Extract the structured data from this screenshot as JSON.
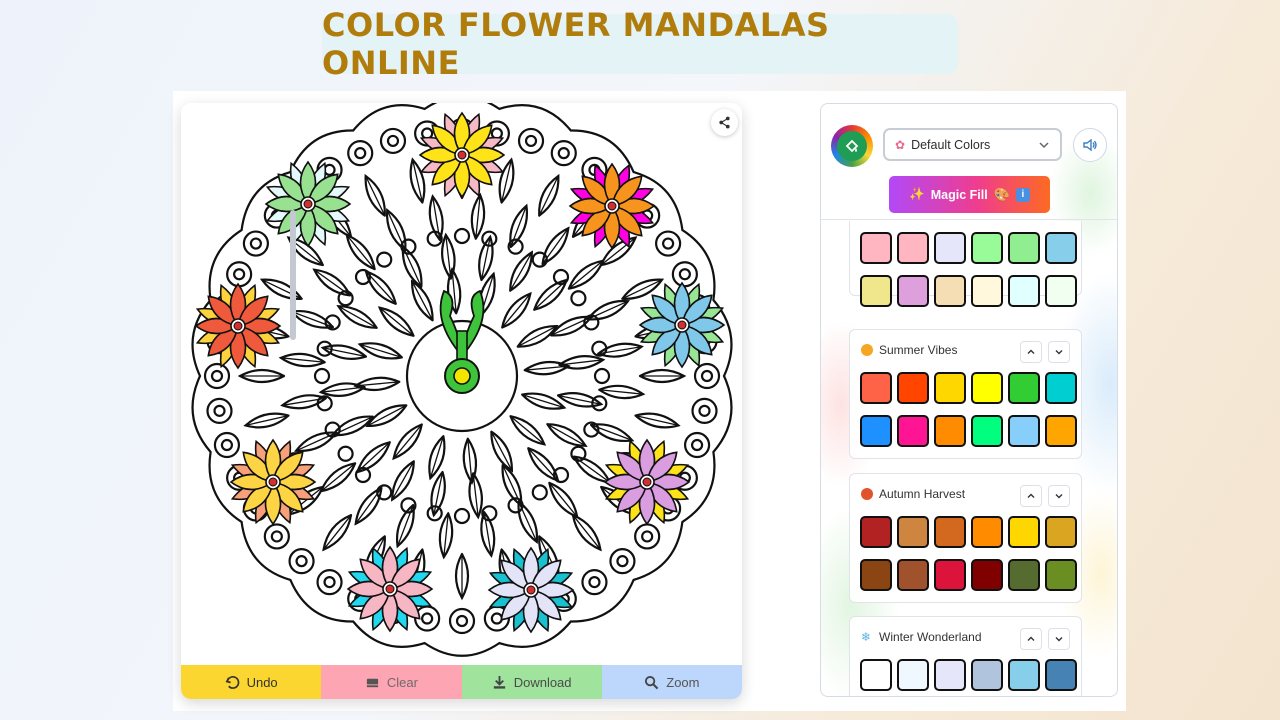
{
  "page": {
    "title": "COLOR FLOWER MANDALAS ONLINE"
  },
  "canvas": {
    "share_icon": "share-icon",
    "petal_colors": {
      "top": "#fde318",
      "top_alt": "#f8b9c6",
      "top_right": "#f7941d",
      "top_right_alt": "#ff00e0",
      "right": "#80c8ea",
      "right_alt": "#98e596",
      "bottom_right": "#d99de0",
      "bottom_right_alt": "#fde318",
      "bottom_center_right": "#e3e4f7",
      "bottom_center_right_alt": "#18c0d0",
      "bottom_center_left": "#f7b6c4",
      "bottom_center_left_alt": "#22d8ee",
      "bottom_left": "#fcd444",
      "bottom_left_alt": "#f8a07a",
      "left": "#f05a3c",
      "left_alt": "#fdd23c",
      "top_left": "#97e191",
      "top_left_alt": "#e5f8fa",
      "stem": "#3ec43a",
      "bud": "#f2e600"
    }
  },
  "actions": {
    "undo": "Undo",
    "clear": "Clear",
    "download": "Download",
    "zoom": "Zoom"
  },
  "panel": {
    "palette_select": "Default Colors",
    "magic_fill": "Magic Fill",
    "sound_icon": "speaker-icon",
    "groups": [
      {
        "name": "",
        "colors": [
          "#ffb6c1",
          "#ffb6c1",
          "#e6e6fa",
          "#98fb98",
          "#90ee90",
          "#87ceeb",
          "#f0e68c",
          "#dda0dd",
          "#f5deb3",
          "#fff8dc",
          "#e0ffff",
          "#f0fff0"
        ]
      },
      {
        "name": "Summer Vibes",
        "icon": "sun-icon",
        "colors": [
          "#ff6347",
          "#ff4500",
          "#ffd700",
          "#ffff00",
          "#32cd32",
          "#00ced1",
          "#1e90ff",
          "#ff1493",
          "#ff8c00",
          "#00ff7f",
          "#87cefa",
          "#ffa500"
        ]
      },
      {
        "name": "Autumn Harvest",
        "icon": "leaf-icon",
        "colors": [
          "#b22222",
          "#cd853f",
          "#d2691e",
          "#ff8c00",
          "#ffd700",
          "#daa520",
          "#8b4513",
          "#a0522d",
          "#dc143c",
          "#800000",
          "#556b2f",
          "#6b8e23"
        ]
      },
      {
        "name": "Winter Wonderland",
        "icon": "snowflake-icon",
        "colors": [
          "#ffffff",
          "#f0f8ff",
          "#e6e6fa",
          "#b0c4de",
          "#87ceeb",
          "#4682b4"
        ]
      }
    ]
  }
}
